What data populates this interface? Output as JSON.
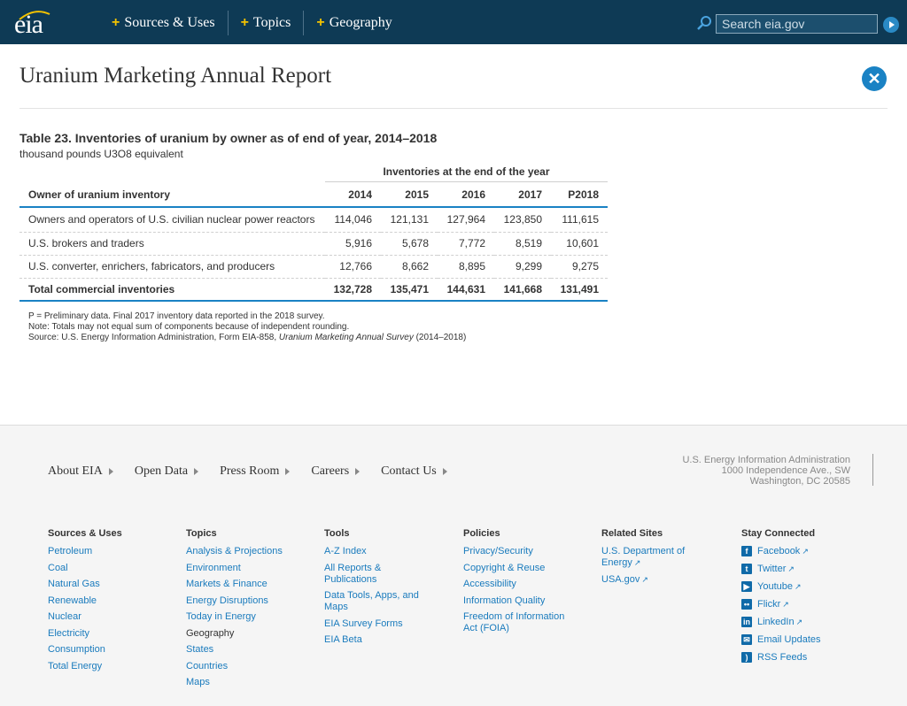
{
  "header": {
    "logo_text": "eia",
    "nav": [
      {
        "label": "Sources & Uses"
      },
      {
        "label": "Topics"
      },
      {
        "label": "Geography"
      }
    ],
    "search_placeholder": "Search eia.gov",
    "colors": {
      "bar": "#0e3a55",
      "plus": "#f2c200",
      "accent": "#1a82c4"
    }
  },
  "page": {
    "title": "Uranium Marketing Annual Report"
  },
  "table": {
    "title": "Table 23. Inventories of uranium by owner as of end of year, 2014–2018",
    "subtitle": "thousand pounds U3O8 equivalent",
    "group_header": "Inventories at the end of the year",
    "columns": [
      "Owner of uranium inventory",
      "2014",
      "2015",
      "2016",
      "2017",
      "P2018"
    ],
    "rows": [
      [
        "Owners and operators of U.S. civilian nuclear power reactors",
        "114,046",
        "121,131",
        "127,964",
        "123,850",
        "111,615"
      ],
      [
        "U.S. brokers and traders",
        "5,916",
        "5,678",
        "7,772",
        "8,519",
        "10,601"
      ],
      [
        "U.S. converter, enrichers, fabricators, and producers",
        "12,766",
        "8,662",
        "8,895",
        "9,299",
        "9,275"
      ],
      [
        "Total commercial inventories",
        "132,728",
        "135,471",
        "144,631",
        "141,668",
        "131,491"
      ]
    ],
    "notes": {
      "line1": "P = Preliminary data. Final 2017 inventory data reported in the 2018 survey.",
      "line2": "Note: Totals may not equal sum of components because of independent rounding.",
      "source_prefix": "Source: U.S. Energy Information Administration, Form EIA-858, ",
      "source_title": "Uranium Marketing Annual Survey",
      "source_suffix": " (2014–2018)"
    }
  },
  "footer": {
    "nav": [
      "About EIA",
      "Open Data",
      "Press Room",
      "Careers",
      "Contact Us"
    ],
    "address": [
      "U.S. Energy Information Administration",
      "1000 Independence Ave., SW",
      "Washington, DC 20585"
    ],
    "columns": {
      "sources": {
        "head": "Sources & Uses",
        "links": [
          "Petroleum",
          "Coal",
          "Natural Gas",
          "Renewable",
          "Nuclear",
          "Electricity",
          "Consumption",
          "Total Energy"
        ]
      },
      "topics": {
        "head": "Topics",
        "links": [
          "Analysis & Projections",
          "Environment",
          "Markets & Finance",
          "Energy Disruptions",
          "Today in Energy"
        ],
        "subhead": "Geography",
        "links2": [
          "States",
          "Countries",
          "Maps"
        ]
      },
      "tools": {
        "head": "Tools",
        "links": [
          "A-Z Index",
          "All Reports & Publications",
          "Data Tools, Apps, and Maps",
          "EIA Survey Forms",
          "EIA Beta"
        ]
      },
      "policies": {
        "head": "Policies",
        "links": [
          "Privacy/Security",
          "Copyright & Reuse",
          "Accessibility",
          "Information Quality",
          "Freedom of Information Act (FOIA)"
        ]
      },
      "related": {
        "head": "Related Sites",
        "links": [
          "U.S. Department of Energy",
          "USA.gov"
        ]
      },
      "social": {
        "head": "Stay Connected",
        "links": [
          "Facebook",
          "Twitter",
          "Youtube",
          "Flickr",
          "LinkedIn",
          "Email Updates",
          "RSS Feeds"
        ]
      }
    }
  }
}
